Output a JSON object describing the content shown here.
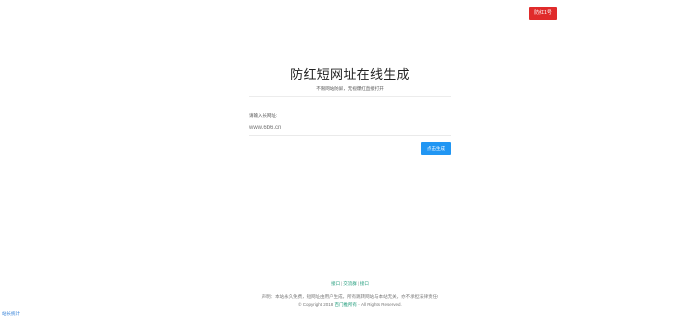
{
  "header": {
    "top_button_label": "防红1号"
  },
  "main": {
    "title": "防红短网址在线生成",
    "subtitle": "不限网站防屏，无视爆红直接打开",
    "input_label": "请输入长网址:",
    "input_placeholder": "www.6b6.cn",
    "generate_button": "点击生成"
  },
  "footer": {
    "links": [
      "接口",
      "交流群",
      "接口"
    ],
    "disclaimer": "声明：本站永久免费，短网址由用户生成，所有跳转网站与本站无关，亦不承担法律责任!",
    "copyright_prefix": "© Copyright 2018",
    "copyright_brand": "百门推所有",
    "copyright_suffix": "- All Rights Reserved.",
    "stats_link": "站长统计"
  },
  "colors": {
    "accent_red": "#e02b2b",
    "accent_blue": "#2196f3",
    "link_green": "#1e9b7a"
  }
}
